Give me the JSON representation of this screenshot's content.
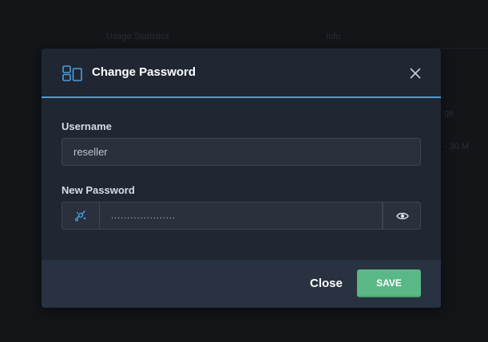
{
  "background": {
    "text_left": "Usage Statistics",
    "text_right": "Info",
    "text_edge_1": "ge",
    "text_edge_2": "- 30 M"
  },
  "modal": {
    "title": "Change Password",
    "header_icon": "layout-icon",
    "close_icon": "close-icon",
    "accent_color": "#4a9fdf"
  },
  "form": {
    "username_label": "Username",
    "username_value": "reseller",
    "password_label": "New Password",
    "password_value": "....................",
    "generate_icon": "generate-password-icon",
    "toggle_icon": "eye-icon"
  },
  "footer": {
    "close_label": "Close",
    "save_label": "SAVE",
    "save_color": "#5ab887"
  }
}
